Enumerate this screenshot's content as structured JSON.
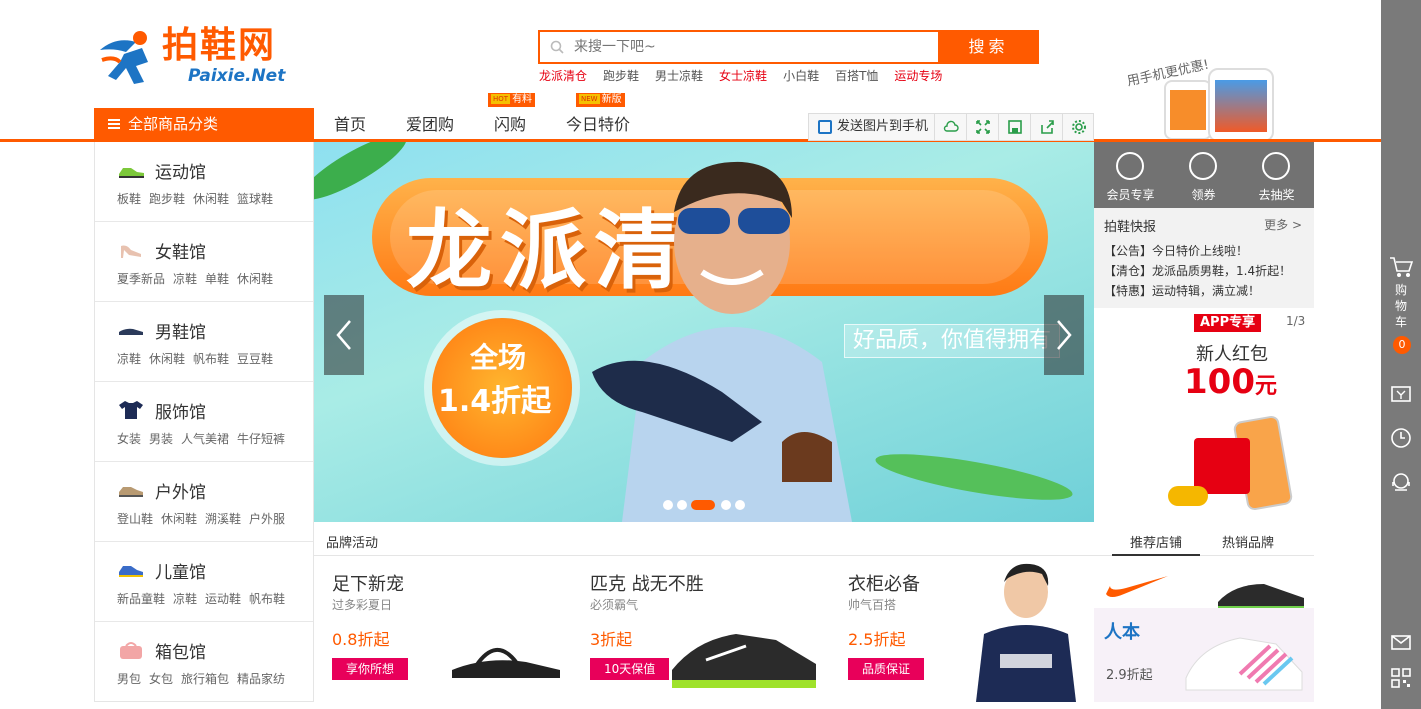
{
  "logo": {
    "name": "拍鞋网",
    "sub": "Paixie.Net"
  },
  "search": {
    "placeholder": "来搜一下吧~",
    "button": "搜索"
  },
  "hotwords": [
    "龙派清仓",
    "跑步鞋",
    "男士凉鞋",
    "女士凉鞋",
    "小白鞋",
    "百搭T恤",
    "运动专场"
  ],
  "phone_promo": "用手机更优惠!",
  "nav": {
    "all_categories": "全部商品分类",
    "items": [
      "首页",
      "爱团购",
      "闪购",
      "今日特价"
    ],
    "badge_hot": {
      "tag": "HOT",
      "label": "有料"
    },
    "badge_new": {
      "tag": "NEW",
      "label": "新版"
    }
  },
  "toolbar": {
    "send": "发送图片到手机"
  },
  "categories": [
    {
      "title": "运动馆",
      "subs": [
        "板鞋",
        "跑步鞋",
        "休闲鞋",
        "篮球鞋"
      ]
    },
    {
      "title": "女鞋馆",
      "subs": [
        "夏季新品",
        "凉鞋",
        "单鞋",
        "休闲鞋"
      ]
    },
    {
      "title": "男鞋馆",
      "subs": [
        "凉鞋",
        "休闲鞋",
        "帆布鞋",
        "豆豆鞋"
      ]
    },
    {
      "title": "服饰馆",
      "subs": [
        "女装",
        "男装",
        "人气美裙",
        "牛仔短裤"
      ]
    },
    {
      "title": "户外馆",
      "subs": [
        "登山鞋",
        "休闲鞋",
        "溯溪鞋",
        "户外服"
      ]
    },
    {
      "title": "儿童馆",
      "subs": [
        "新品童鞋",
        "凉鞋",
        "运动鞋",
        "帆布鞋"
      ]
    },
    {
      "title": "箱包馆",
      "subs": [
        "男包",
        "女包",
        "旅行箱包",
        "精品家纺"
      ]
    }
  ],
  "banner": {
    "headline": "龙派清仓",
    "circle_line1": "全场",
    "circle_line2": "1.4折起",
    "slogan": "好品质，你值得拥有"
  },
  "quick": [
    "会员专享",
    "领券",
    "去抽奖"
  ],
  "news": {
    "title": "拍鞋快报",
    "more": "更多 >",
    "items": [
      "【公告】今日特价上线啦！",
      "【清仓】龙派品质男鞋，1.4折起！",
      "【特惠】运动特辑，满立减！"
    ]
  },
  "app_promo": {
    "tag": "APP专享",
    "page": "1/3",
    "line1": "新人红包",
    "amount": "100",
    "unit": "元"
  },
  "brand_section": {
    "label": "品牌活动",
    "tabs": [
      "推荐店铺",
      "热销品牌"
    ],
    "promos": [
      {
        "title": "足下新宠",
        "sub": "过多彩夏日",
        "discount": "0.8折起",
        "button": "享你所想"
      },
      {
        "title": "匹克 战无不胜",
        "sub": "必须霸气",
        "discount": "3折起",
        "button": "10天保值"
      },
      {
        "title": "衣柜必备",
        "sub": "帅气百搭",
        "discount": "2.5折起",
        "button": "品质保证"
      }
    ],
    "brand2": {
      "name": "人本",
      "discount": "2.9折起"
    }
  },
  "sidebar": {
    "cart": "购物车",
    "cart_count": "0"
  },
  "colors": {
    "accent": "#ff5a00",
    "red": "#e60012",
    "pink": "#e8005a",
    "gray_bar": "#7a7a7a"
  }
}
